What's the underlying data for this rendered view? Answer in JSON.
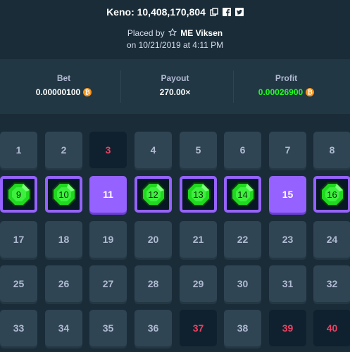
{
  "header": {
    "title": "Keno: 10,408,170,804",
    "placed_by_label": "Placed by",
    "user": "ME Viksen",
    "date_line": "on 10/21/2019 at 4:11 PM"
  },
  "stats": {
    "bet_label": "Bet",
    "bet_value": "0.00000100",
    "payout_label": "Payout",
    "payout_value": "270.00×",
    "profit_label": "Profit",
    "profit_value": "0.00026900"
  },
  "colors": {
    "background": "#1a2c38",
    "stats_bg": "#213743",
    "tile": "#2f4553",
    "miss_tile": "#0f212e",
    "miss_text": "#ed4163",
    "selected": "#9562ff",
    "profit_text": "#1fff20",
    "gem": "#1fd81f",
    "coin": "#f7931a"
  },
  "icons": {
    "copy": "copy-icon",
    "facebook": "facebook-icon",
    "twitter": "twitter-icon",
    "star": "star-outline-icon",
    "coin": "bitcoin-icon",
    "gem": "emerald-gem-icon"
  },
  "tiles": [
    {
      "n": "1",
      "state": "normal"
    },
    {
      "n": "2",
      "state": "normal"
    },
    {
      "n": "3",
      "state": "miss"
    },
    {
      "n": "4",
      "state": "normal"
    },
    {
      "n": "5",
      "state": "normal"
    },
    {
      "n": "6",
      "state": "normal"
    },
    {
      "n": "7",
      "state": "normal"
    },
    {
      "n": "8",
      "state": "normal"
    },
    {
      "n": "9",
      "state": "hit"
    },
    {
      "n": "10",
      "state": "hit"
    },
    {
      "n": "11",
      "state": "pick"
    },
    {
      "n": "12",
      "state": "hit"
    },
    {
      "n": "13",
      "state": "hit"
    },
    {
      "n": "14",
      "state": "hit"
    },
    {
      "n": "15",
      "state": "pick"
    },
    {
      "n": "16",
      "state": "hit"
    },
    {
      "n": "17",
      "state": "normal"
    },
    {
      "n": "18",
      "state": "normal"
    },
    {
      "n": "19",
      "state": "normal"
    },
    {
      "n": "20",
      "state": "normal"
    },
    {
      "n": "21",
      "state": "normal"
    },
    {
      "n": "22",
      "state": "normal"
    },
    {
      "n": "23",
      "state": "normal"
    },
    {
      "n": "24",
      "state": "normal"
    },
    {
      "n": "25",
      "state": "normal"
    },
    {
      "n": "26",
      "state": "normal"
    },
    {
      "n": "27",
      "state": "normal"
    },
    {
      "n": "28",
      "state": "normal"
    },
    {
      "n": "29",
      "state": "normal"
    },
    {
      "n": "30",
      "state": "normal"
    },
    {
      "n": "31",
      "state": "normal"
    },
    {
      "n": "32",
      "state": "normal"
    },
    {
      "n": "33",
      "state": "normal"
    },
    {
      "n": "34",
      "state": "normal"
    },
    {
      "n": "35",
      "state": "normal"
    },
    {
      "n": "36",
      "state": "normal"
    },
    {
      "n": "37",
      "state": "miss"
    },
    {
      "n": "38",
      "state": "normal"
    },
    {
      "n": "39",
      "state": "miss"
    },
    {
      "n": "40",
      "state": "miss"
    }
  ]
}
